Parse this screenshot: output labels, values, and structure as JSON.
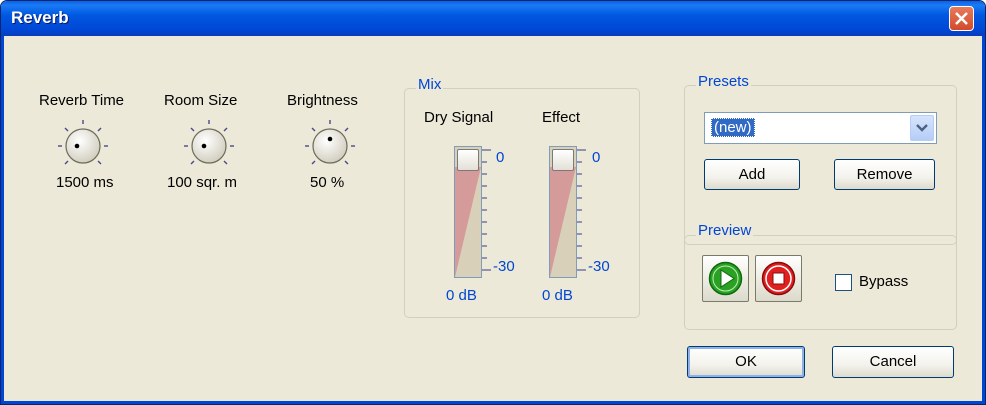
{
  "window": {
    "title": "Reverb",
    "close_icon": "close-icon"
  },
  "knobs": [
    {
      "label": "Reverb Time",
      "value": "1500 ms"
    },
    {
      "label": "Room Size",
      "value": "100 sqr. m"
    },
    {
      "label": "Brightness",
      "value": "50 %"
    }
  ],
  "mix": {
    "legend": "Mix",
    "sliders": [
      {
        "label": "Dry Signal",
        "top_tick": "0",
        "bottom_tick": "-30",
        "value": "0 dB"
      },
      {
        "label": "Effect",
        "top_tick": "0",
        "bottom_tick": "-30",
        "value": "0 dB"
      }
    ]
  },
  "presets": {
    "legend": "Presets",
    "selected": "(new)",
    "add_label": "Add",
    "remove_label": "Remove"
  },
  "preview": {
    "legend": "Preview",
    "bypass_label": "Bypass",
    "bypass_checked": false
  },
  "ok_label": "OK",
  "cancel_label": "Cancel",
  "colors": {
    "title_blue": "#0046d5",
    "dialog_bg": "#ece9d8",
    "play_green": "#2aa024",
    "stop_red": "#e02020"
  }
}
